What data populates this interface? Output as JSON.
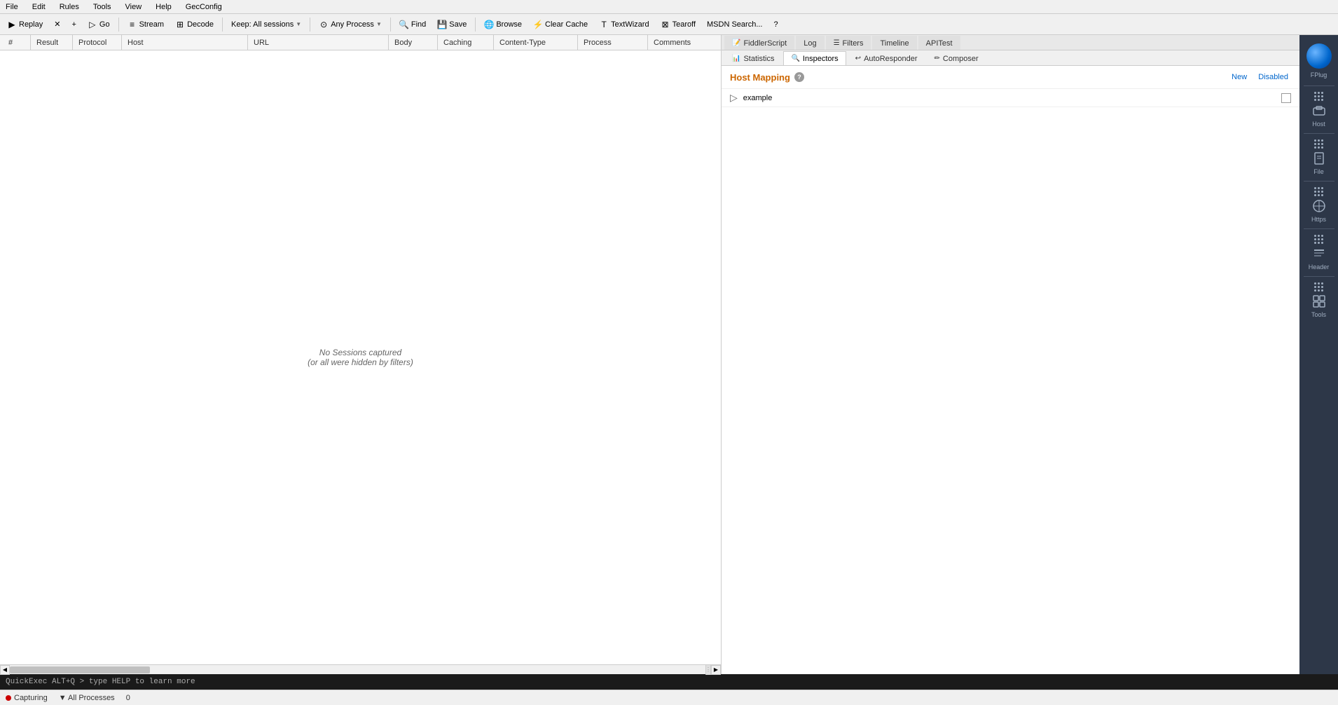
{
  "menu": {
    "items": [
      "File",
      "Edit",
      "Rules",
      "Tools",
      "View",
      "Help",
      "GecConfig"
    ]
  },
  "toolbar": {
    "buttons": [
      {
        "id": "replay",
        "label": "Replay",
        "icon": "▶"
      },
      {
        "id": "close",
        "label": "✕",
        "icon": ""
      },
      {
        "id": "go",
        "label": "Go",
        "icon": ""
      },
      {
        "id": "stream",
        "label": "Stream",
        "icon": ""
      },
      {
        "id": "decode",
        "label": "Decode",
        "icon": ""
      },
      {
        "id": "keep",
        "label": "Keep: All sessions",
        "icon": "",
        "dropdown": true
      },
      {
        "id": "any-process",
        "label": "Any Process",
        "icon": "",
        "dropdown": true
      },
      {
        "id": "find",
        "label": "Find",
        "icon": ""
      },
      {
        "id": "save",
        "label": "Save",
        "icon": ""
      },
      {
        "id": "browse",
        "label": "Browse",
        "icon": ""
      },
      {
        "id": "clear-cache",
        "label": "Clear Cache",
        "icon": ""
      },
      {
        "id": "text-wizard",
        "label": "TextWizard",
        "icon": ""
      },
      {
        "id": "tearoff",
        "label": "Tearoff",
        "icon": ""
      },
      {
        "id": "msdn-search",
        "label": "MSDN Search...",
        "icon": ""
      },
      {
        "id": "help",
        "label": "?",
        "icon": ""
      }
    ]
  },
  "columns": {
    "headers": [
      "Host",
      "URL",
      "",
      "Body",
      "Caching",
      "Content-Type",
      "Process",
      "Comments"
    ]
  },
  "sessions": {
    "empty_line1": "No Sessions captured",
    "empty_line2": "(or all were hidden by filters)"
  },
  "right_panel": {
    "tabs_row1": [
      {
        "id": "fiddlerscript",
        "label": "FiddlerScript",
        "active": false
      },
      {
        "id": "log",
        "label": "Log",
        "active": false
      },
      {
        "id": "filters",
        "label": "Filters",
        "active": false
      },
      {
        "id": "timeline",
        "label": "Timeline",
        "active": false
      },
      {
        "id": "apitest",
        "label": "APITest",
        "active": false
      }
    ],
    "tabs_row2": [
      {
        "id": "statistics",
        "label": "Statistics",
        "active": false
      },
      {
        "id": "inspectors",
        "label": "Inspectors",
        "active": true
      },
      {
        "id": "autoresponder",
        "label": "AutoResponder",
        "active": false
      },
      {
        "id": "composer",
        "label": "Composer",
        "active": false
      }
    ],
    "host_mapping": {
      "title": "Host Mapping",
      "actions": [
        "New",
        "Disabled"
      ],
      "entries": [
        {
          "text": "example",
          "checked": false
        }
      ]
    }
  },
  "sidebar": {
    "items": [
      {
        "id": "host",
        "label": "Host"
      },
      {
        "id": "file",
        "label": "File"
      },
      {
        "id": "https",
        "label": "Https"
      },
      {
        "id": "header",
        "label": "Header"
      },
      {
        "id": "tools",
        "label": "Tools"
      }
    ]
  },
  "status_bar": {
    "capture_label": "Capturing",
    "process_label": "All Processes",
    "count": "0"
  },
  "quickexec": {
    "text": "QuickExec ALT+Q > type HELP to learn more"
  }
}
